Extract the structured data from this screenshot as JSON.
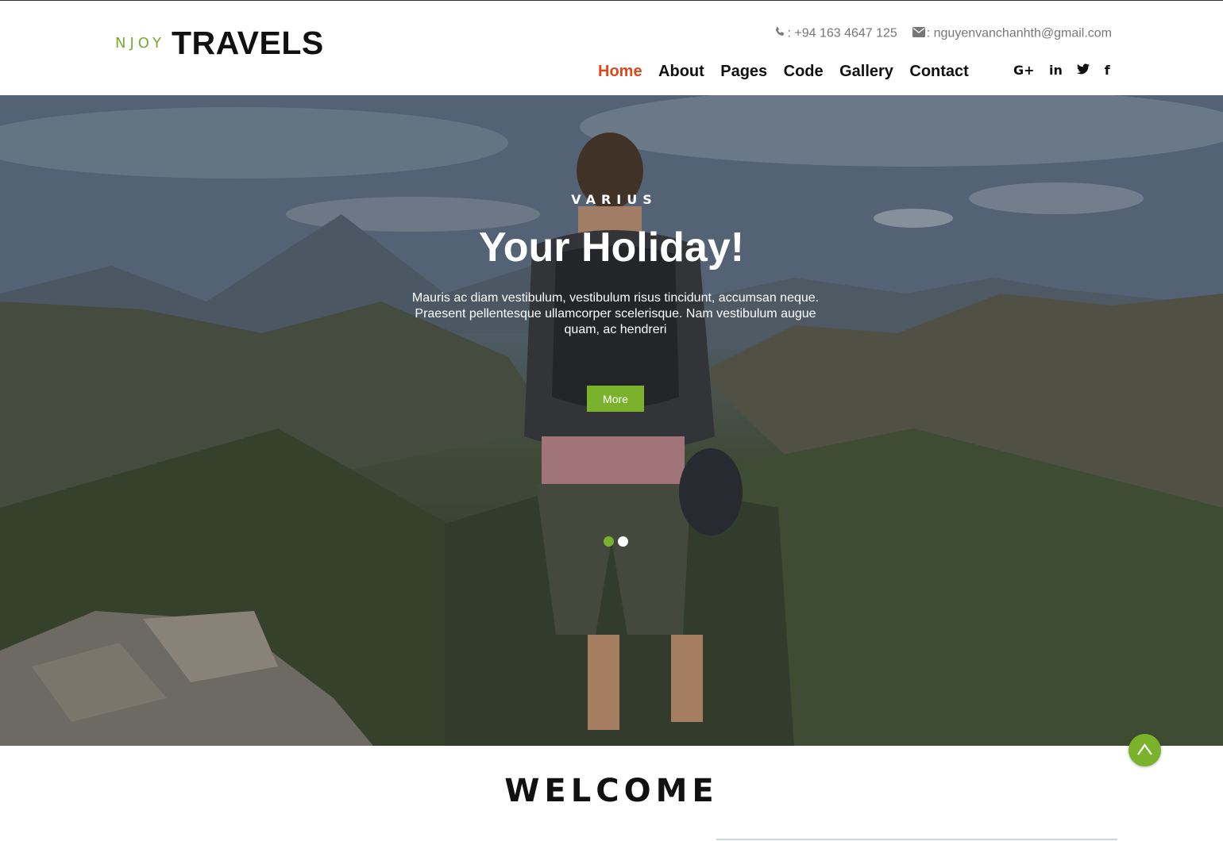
{
  "brand": {
    "prefix": "NJOY",
    "name": "TRAVELS"
  },
  "contact": {
    "phone": ": +94 163 4647 125",
    "email": ": nguyenvanchanhth@gmail.com",
    "phone_icon": "phone-icon",
    "email_icon": "envelope-icon"
  },
  "nav": {
    "items": [
      {
        "label": "Home",
        "active": true
      },
      {
        "label": "About"
      },
      {
        "label": "Pages"
      },
      {
        "label": "Code"
      },
      {
        "label": "Gallery"
      },
      {
        "label": "Contact"
      }
    ]
  },
  "social": {
    "google_plus": "G+",
    "linkedin": "in",
    "twitter_icon": "twitter-icon",
    "facebook": "f"
  },
  "hero": {
    "eyebrow": "VARIUS",
    "title": "Your Holiday!",
    "text": "Mauris ac diam vestibulum, vestibulum risus tincidunt, accumsan neque. Praesent pellentesque ullamcorper scelerisque. Nam vestibulum augue quam, ac hendreri",
    "button": "More",
    "slides_total": 2,
    "active_slide": 1
  },
  "welcome": {
    "title": "WELCOME"
  },
  "colors": {
    "accent": "#7ab32b",
    "nav_active": "#d94a1e",
    "logo_prefix": "#7aaa2a",
    "text_dark": "#111111",
    "contact_text": "#777777"
  },
  "icons": {
    "scroll_top": "chevron-up-icon"
  }
}
